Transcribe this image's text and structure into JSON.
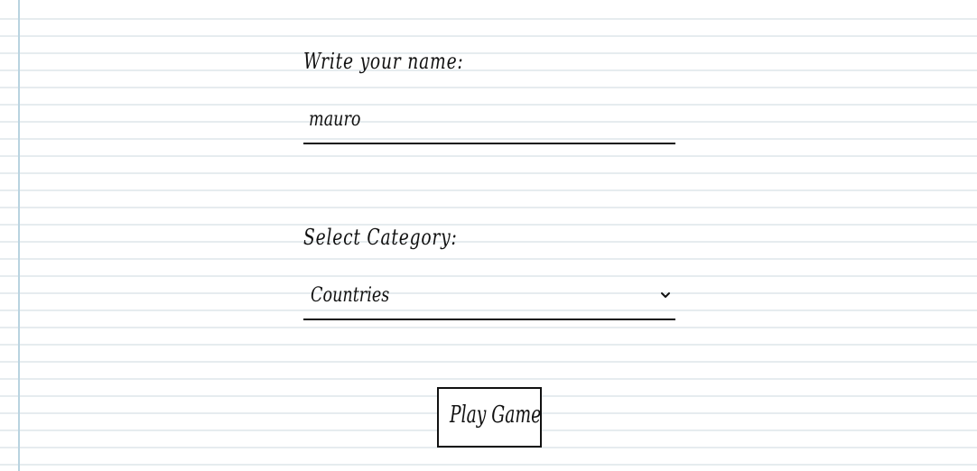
{
  "form": {
    "name_label": "Write your name:",
    "name_value": "mauro",
    "category_label": "Select Category:",
    "category_selected": "Countries",
    "play_button_label": "Play Game"
  },
  "icons": {
    "select_arrow": "chevron-down-icon"
  },
  "colors": {
    "margin_line": "#b9d3e0",
    "ruled_line": "#e6ecef",
    "ink": "#111111"
  }
}
